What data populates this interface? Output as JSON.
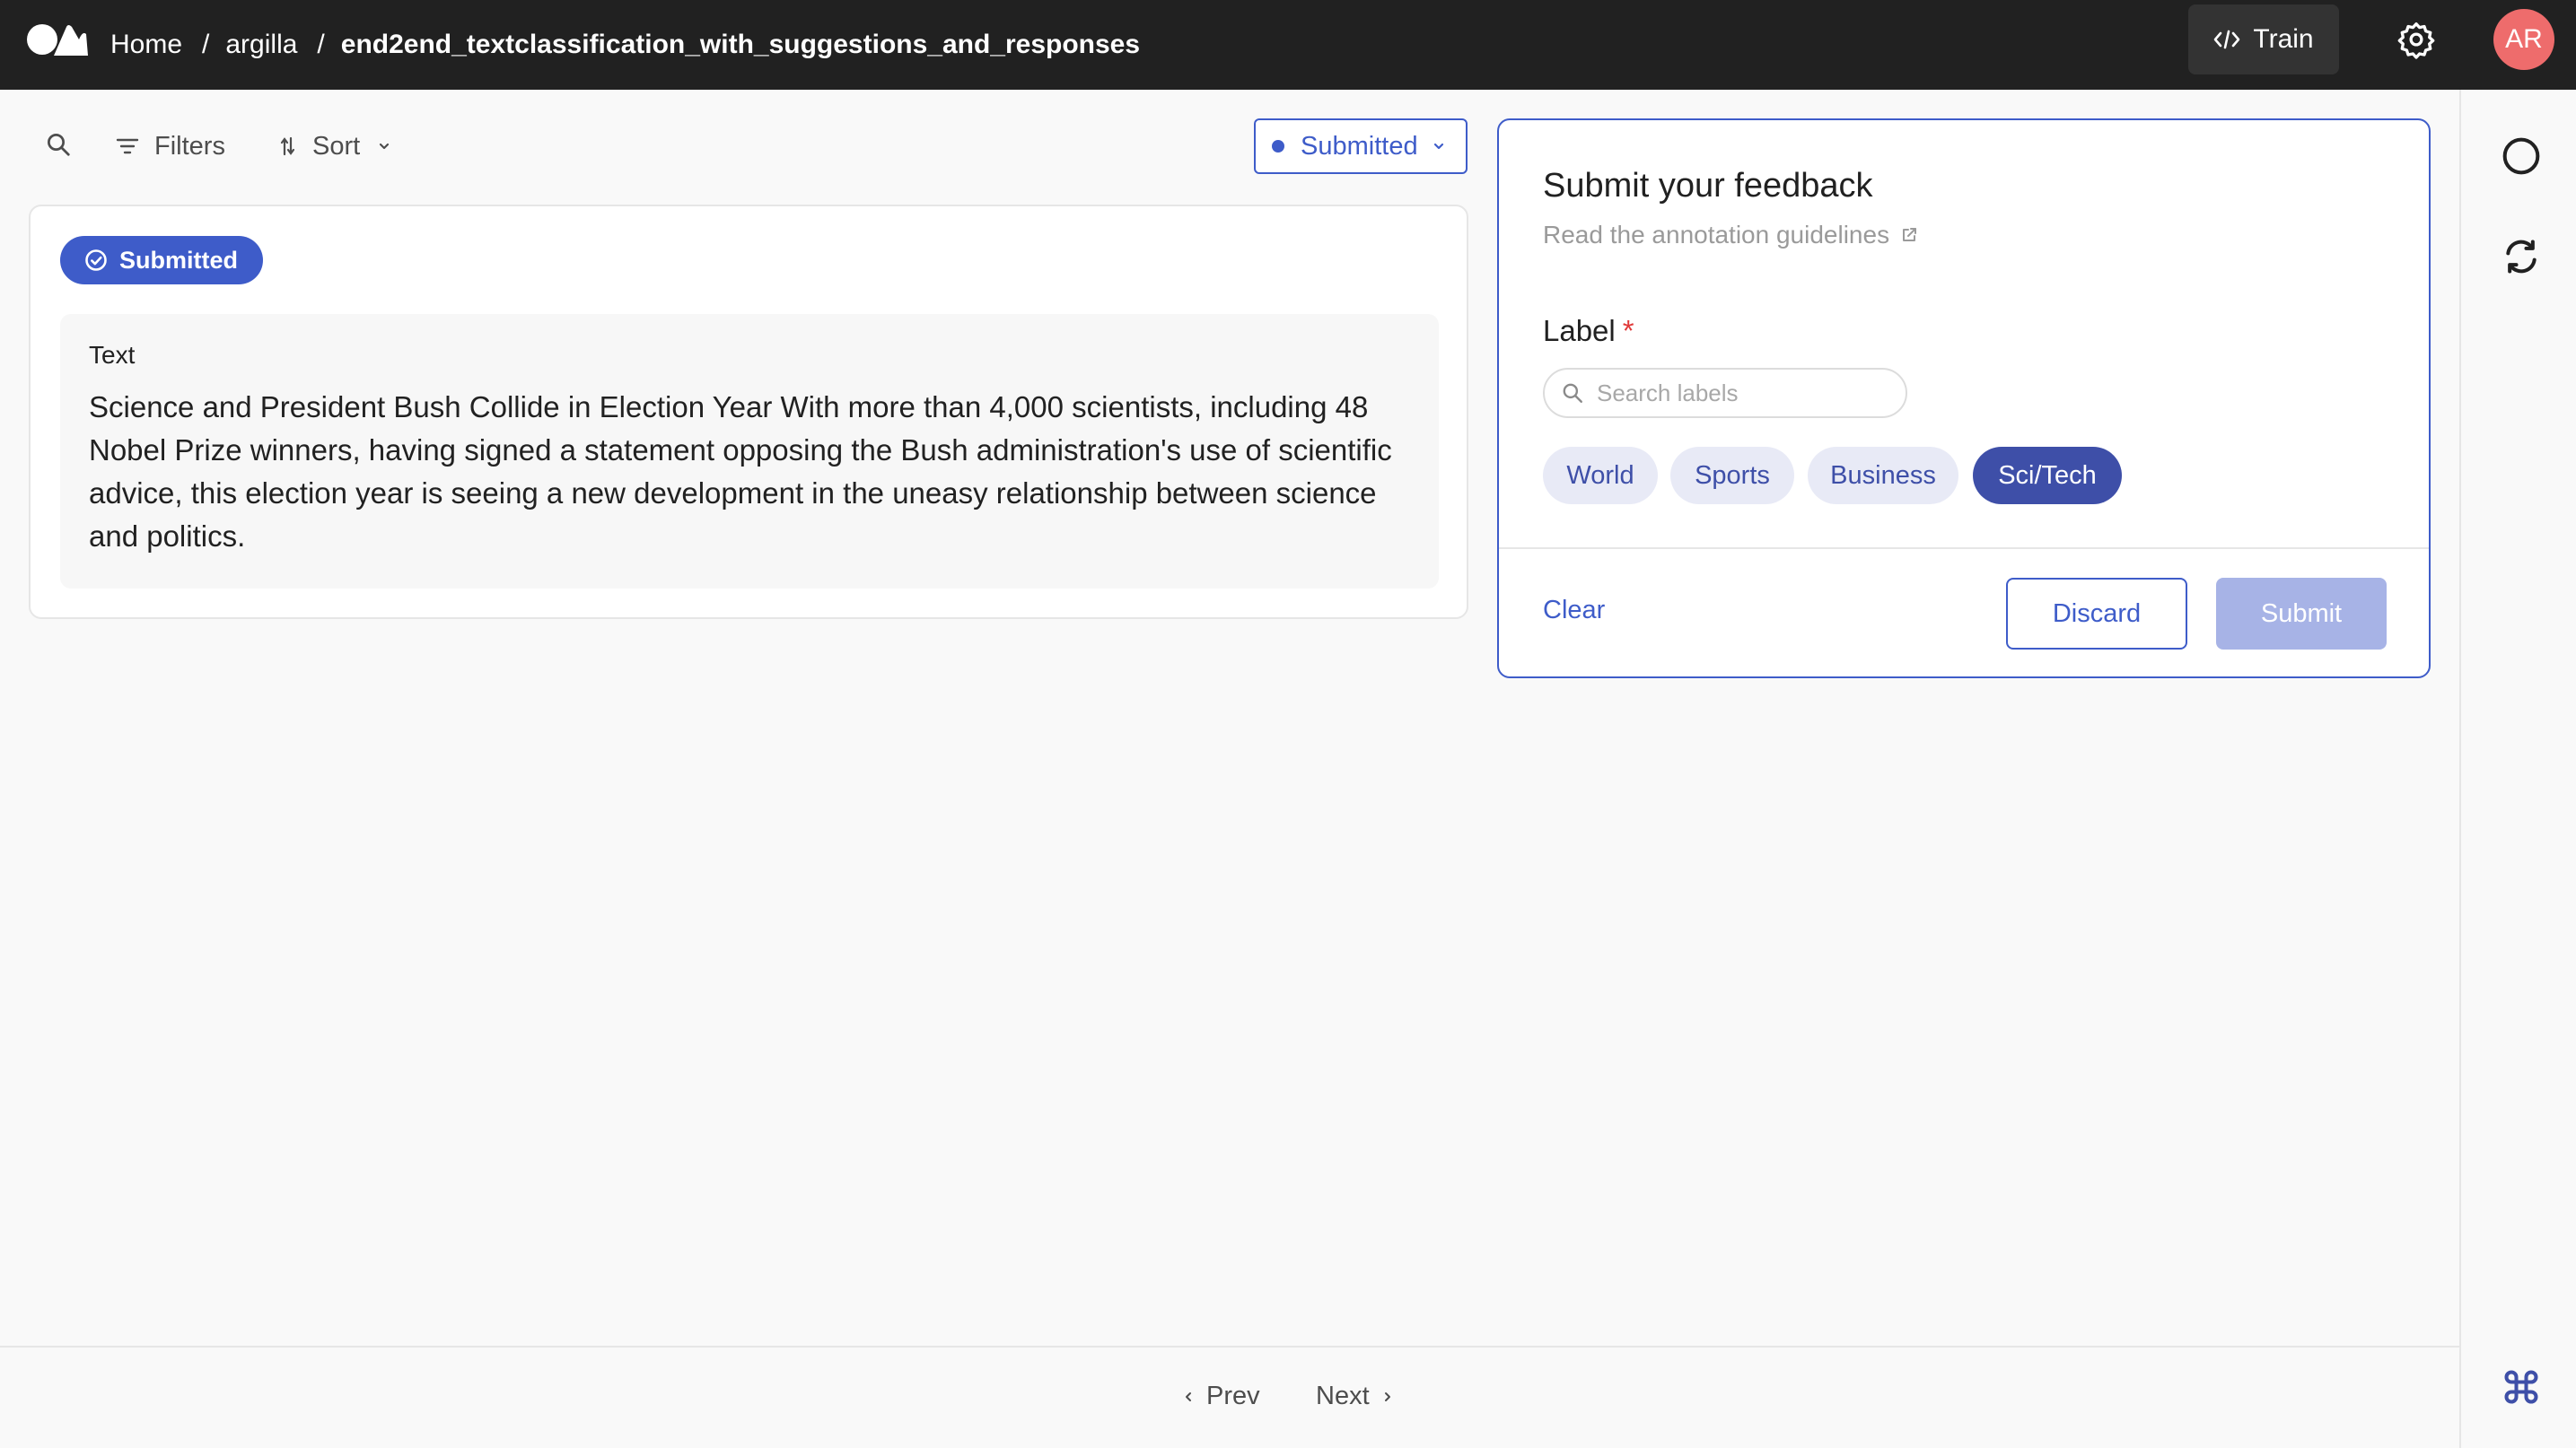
{
  "header": {
    "breadcrumb": [
      "Home",
      "argilla",
      "end2end_textclassification_with_suggestions_and_responses"
    ],
    "separator": "/",
    "train_label": "Train",
    "avatar_initials": "AR"
  },
  "toolbar": {
    "filters_label": "Filters",
    "sort_label": "Sort",
    "status_value": "Submitted"
  },
  "record": {
    "status_badge": "Submitted",
    "field_title": "Text",
    "field_text": "Science and President Bush Collide in Election Year With more than 4,000 scientists, including 48 Nobel Prize winners, having signed a statement opposing the Bush administration's use of scientific advice, this election year is seeing a new development in the uneasy relationship between science and politics."
  },
  "feedback": {
    "title": "Submit your feedback",
    "guidelines_link": "Read the annotation guidelines",
    "question_title": "Label",
    "required_mark": "*",
    "search_placeholder": "Search labels",
    "labels": [
      "World",
      "Sports",
      "Business",
      "Sci/Tech"
    ],
    "selected_label": "Sci/Tech",
    "clear_label": "Clear",
    "discard_label": "Discard",
    "submit_label": "Submit"
  },
  "footer": {
    "prev_label": "Prev",
    "next_label": "Next"
  },
  "colors": {
    "accent": "#3e5cc9",
    "chip_bg": "#e8eaf6",
    "chip_selected": "#3e4fa8",
    "topbar": "#212121",
    "avatar": "#ee6c6c"
  }
}
